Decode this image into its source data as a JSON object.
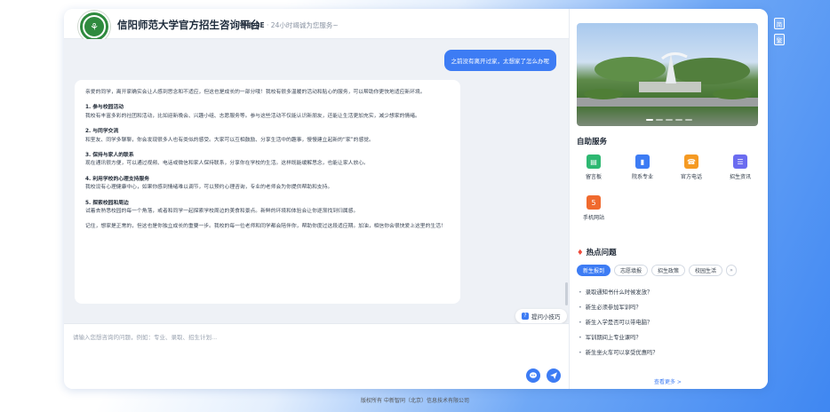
{
  "header": {
    "title": "信阳师范大学官方招生咨询平台",
    "assistant_name": "智能小E",
    "assistant_tagline": "24小时竭诚为您服务~"
  },
  "chat": {
    "user_message": "之前没有离开过家，太想家了怎么办呢",
    "bot_intro": "亲爱的同学，离开家确实会让人感到思念和不适应，但这也是成长的一部分哦！我校有很多温暖的活动和贴心的服务，可以帮助你更快地适应新环境。",
    "bot_items": [
      {
        "heading": "1. 参与校园活动",
        "text": "我校有丰富多彩的社团和活动，比如迎新晚会、兴趣小组、志愿服务等。参与这些活动不仅能认识新朋友，还能让生活更加充实，减少想家的情绪。"
      },
      {
        "heading": "2. 与同学交流",
        "text": "和室友、同学多聊聊，你会发现很多人也有类似的感受。大家可以互相鼓励、分享生活中的趣事，慢慢建立起新的“家”的感觉。"
      },
      {
        "heading": "3. 保持与家人的联系",
        "text": "现在通讯很方便，可以通过视频、电话或微信和家人保持联系，分享你在学校的生活。这样既能缓解思念，也能让家人放心。"
      },
      {
        "heading": "4. 利用学校的心理支持服务",
        "text": "我校设有心理健康中心，如果你感到情绪难以调节，可以预约心理咨询，专业的老师会为你提供帮助和支持。"
      },
      {
        "heading": "5. 探索校园和周边",
        "text": "试着去熟悉校园的每一个角落，或者和同学一起探索学校周边的美食和景点。新鲜的环境和体验会让你逐渐找到归属感。"
      }
    ],
    "bot_closing": "记住，想家是正常的，但这也是你独立成长的重要一步。我校的每一位老师和同学都会陪伴你，帮助你度过这段适应期。加油，相信你会很快爱上这里的生活！",
    "tip_button": "提问小技巧",
    "input_placeholder": "请输入您想咨询的问题，例如：专业、录取、招生计划..."
  },
  "sidebar": {
    "self_service_title": "自助服务",
    "services": [
      {
        "label": "留言板",
        "icon": "message-board-icon",
        "color": "#2eb872"
      },
      {
        "label": "院系专业",
        "icon": "book-icon",
        "color": "#3d7cf4"
      },
      {
        "label": "官方电话",
        "icon": "phone-icon",
        "color": "#f59a23"
      },
      {
        "label": "招生资讯",
        "icon": "news-icon",
        "color": "#6b6cf0"
      },
      {
        "label": "手机网站",
        "icon": "html5-icon",
        "color": "#f06a2e"
      }
    ],
    "hot_title": "热点问题",
    "hot_tabs": [
      "新生报到",
      "志愿填报",
      "招生政策",
      "校园生活"
    ],
    "questions": [
      "录取通知书什么时候发放？",
      "新生必须参加军训吗？",
      "新生入学是否可以带电脑？",
      "军训期间上专业课吗？",
      "新生坐火车可以享受优惠吗？"
    ],
    "more": "查看更多 >"
  },
  "lang": {
    "simplified": "简",
    "traditional": "繁"
  },
  "footer": "版权所有 中新智同（北京）信息技术有限公司",
  "colors": {
    "accent": "#3d7cf4",
    "chat_bg": "#eef1f6"
  }
}
